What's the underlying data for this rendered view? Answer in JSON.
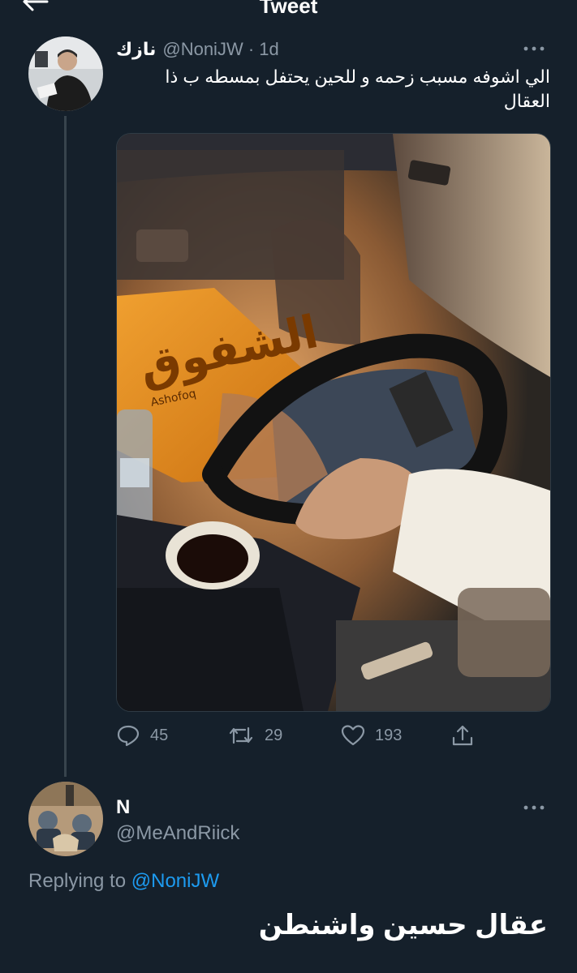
{
  "header": {
    "title": "Tweet",
    "back_icon": "arrow-left-icon"
  },
  "tweet": {
    "display_name": "نازك",
    "handle": "@NoniJW",
    "separator": "·",
    "time": "1d",
    "text": "الي اشوفه مسبب زحمه و للحين يحتفل بمسطه ب ذا العقال",
    "media_overlay_texts": [
      "الشفوق",
      "Ashofoq"
    ],
    "actions": {
      "replies": "45",
      "retweets": "29",
      "likes": "193"
    }
  },
  "reply": {
    "display_name": "N",
    "handle": "@MeAndRiick",
    "replying_prefix": "Replying to",
    "replying_to": "@NoniJW",
    "text": "عقال حسين واشنطن"
  },
  "colors": {
    "background": "#15202b",
    "secondary_text": "#8b98a5",
    "accent": "#1d9bf0",
    "divider": "#38444d"
  }
}
